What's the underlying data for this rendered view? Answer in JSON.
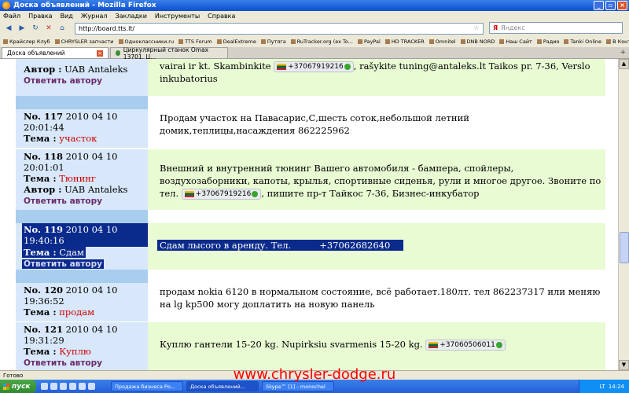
{
  "window": {
    "title": "Доска объявлений - Mozilla Firefox"
  },
  "menu": [
    "Файл",
    "Правка",
    "Вид",
    "Журнал",
    "Закладки",
    "Инструменты",
    "Справка"
  ],
  "nav": {
    "url": "http://board.tts.lt/",
    "search_placeholder": "Яндекс",
    "search_logo": "Я"
  },
  "bookmarks": [
    "Крайслер Клуб",
    "CHRYSLER запчасти",
    "Одноклассники.ru",
    "TTS Forum",
    "DealExtreme",
    "Путяга",
    "RuTracker.org (ex To...",
    "PayPal",
    "HD TRACKER",
    "Omnitel",
    "DNB NORD",
    "Наш Сайт",
    "Радио",
    "Tanki Online",
    "В Контакте | Иван М..."
  ],
  "tabs": [
    {
      "label": "Доска объявлений"
    },
    {
      "label": "Циркулярный станок Omax 13701. Ц..."
    }
  ],
  "posts": [
    {
      "left": {
        "author_label": "Автор :",
        "author": "UAB Antaleks",
        "reply": "Ответить автору"
      },
      "text1": "vairai ir kt. Skambinkite",
      "phone": "+37067919216",
      "text2": ", rašykite tuning@antaleks.lt Taikos pr. 7-36, Verslo inkubatorius"
    },
    {
      "no": "No. 117",
      "date": "2010 04 10 20:01:44",
      "tema_label": "Тема :",
      "tema": "участок",
      "text": "Продам участок на Павасарис,С,шесть соток,небольшой летний домик,теплицы,насаждения 862225962"
    },
    {
      "no": "No. 118",
      "date": "2010 04 10 20:01:01",
      "tema_label": "Тема :",
      "tema": "Тюнинг",
      "author_label": "Автор :",
      "author": "UAB Antaleks",
      "reply": "Ответить автору",
      "text1": "Внешний и внутренний тюнинг Вашего автомобиля - бампера, спойлеры, воздухозаборники, капоты, крылья, спортивные сиденья, рули и многое другое. Звоните по тел.",
      "phone": "+37067919216",
      "text2": ", пишите пр-т Тайкос 7-36, Бизнес-инкубатор"
    },
    {
      "no": "No. 119",
      "date": "2010 04 10 19:40:16",
      "tema_label": "Тема :",
      "tema": "Сдам",
      "reply": "Ответить автору",
      "text": "Сдам лысого в аренду. Тел.",
      "phone": "+37062682640"
    },
    {
      "no": "No. 120",
      "date": "2010 04 10 19:36:52",
      "tema_label": "Тема :",
      "tema": "продам",
      "text": "продам nokia 6120 в нормальном состояние, всё работает.180лт. тел 862237317 или меняю на lg kp500 могу доплатить на новую панель"
    },
    {
      "no": "No. 121",
      "date": "2010 04 10 19:31:29",
      "tema_label": "Тема :",
      "tema": "Куплю",
      "reply": "Ответить автору",
      "text": "Куплю гантели 15-20 kg. Nupirksiu svarmenis 15-20 kg.",
      "phone": "+37060506011"
    }
  ],
  "watermark": "www.chrysler-dodge.ru",
  "status": "Готово",
  "taskbar": {
    "start": "пуск",
    "tasks": [
      "Продажа бизнеса Ро...",
      "Доска объявлений...",
      "Skype™ [1] - monochel"
    ],
    "lang": "LT",
    "time": "14:24"
  },
  "colors": {
    "left_bg": "#d8e8fa",
    "right_bg": "#e8fbd3",
    "separator": "#a8cdee",
    "tema": "#cc0000",
    "reply": "#6a2a6a"
  }
}
